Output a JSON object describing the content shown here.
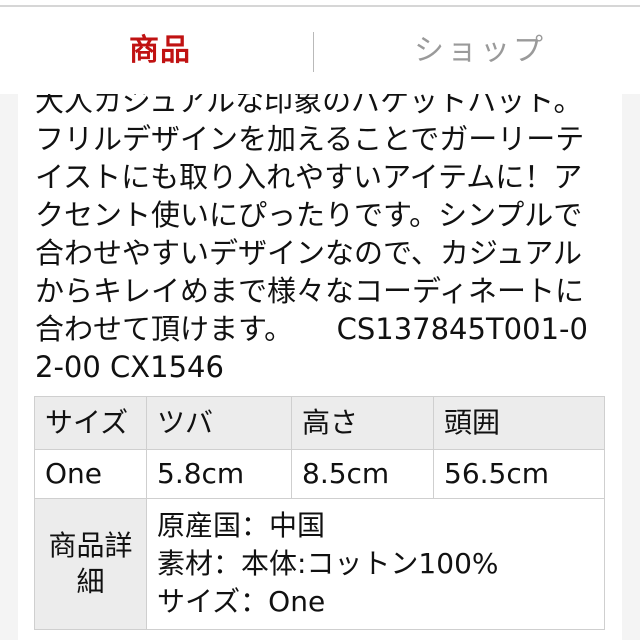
{
  "tabs": [
    {
      "label": "商品",
      "state": "active",
      "color": "#c01212"
    },
    {
      "label": "ショップ",
      "state": "inactive",
      "color": "#9a9a9a"
    }
  ],
  "description": {
    "text": "大人カジュアルな印象のバケットハット。フリルデザインを加えることでガーリーテイストにも取り入れやすいアイテムに！アクセント使いにぴったりです。シンプルで合わせやすいデザインなので、カジュアルからキレイめまで様々なコーディネートに合わせて頂けます。　　CS137845T001-02-00 CX1546",
    "product_code": "CS137845T001-02-00 CX1546"
  },
  "spec_table": {
    "headers": [
      "サイズ",
      "ツバ",
      "高さ",
      "頭囲"
    ],
    "row": [
      "One",
      "5.8cm",
      "8.5cm",
      "56.5cm"
    ],
    "detail_header": "商品詳細",
    "detail_lines": [
      "原産国：中国",
      "素材：本体:コットン100%",
      "サイズ：One"
    ]
  },
  "colors": {
    "accent_red": "#c01212",
    "inactive_gray": "#9a9a9a",
    "table_header_bg": "#ececec",
    "table_border": "#cfcfcf",
    "page_bg": "#f4f4f4"
  }
}
